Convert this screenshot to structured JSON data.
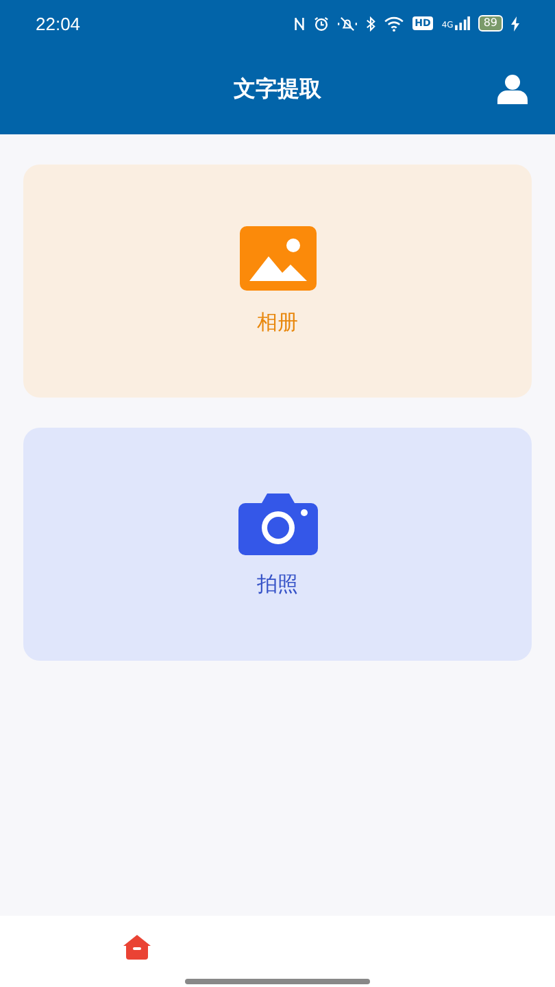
{
  "status_bar": {
    "time": "22:04",
    "hd": "HD",
    "network": "4G",
    "battery": "89"
  },
  "header": {
    "title": "文字提取"
  },
  "cards": [
    {
      "kind": "album",
      "label": "相册"
    },
    {
      "kind": "camera",
      "label": "拍照"
    }
  ],
  "bottom_nav": [
    {
      "kind": "home",
      "selected": true
    }
  ]
}
